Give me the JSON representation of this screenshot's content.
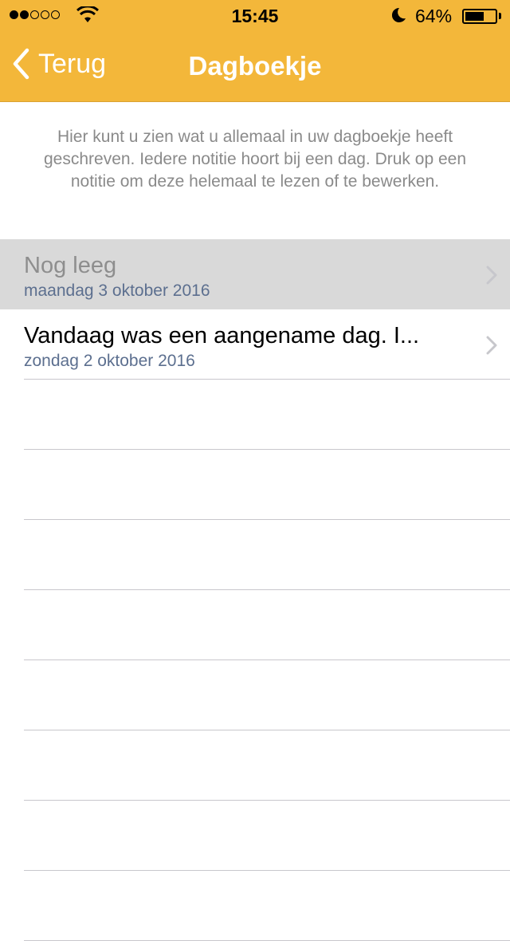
{
  "status_bar": {
    "time": "15:45",
    "battery_percent_label": "64%",
    "battery_level": 0.64,
    "signal_bars": 2,
    "signal_total": 5,
    "icons": [
      "wifi-icon",
      "moon-icon",
      "battery-icon"
    ]
  },
  "nav": {
    "back_label": "Terug",
    "title": "Dagboekje"
  },
  "intro_text": "Hier kunt u zien wat u allemaal in uw dagboekje heeft geschreven. Iedere notitie hoort bij een dag. Druk op een notitie om deze helemaal te lezen of te bewerken.",
  "entries": [
    {
      "title": "Nog leeg",
      "date": "maandag 3 oktober 2016",
      "selected": true
    },
    {
      "title": "Vandaag was een aangename dag. I...",
      "date": "zondag 2 oktober 2016",
      "selected": false
    }
  ],
  "colors": {
    "header": "#f3b73a",
    "date_text": "#5c6f8f",
    "selected_row": "#d9d9d9"
  }
}
